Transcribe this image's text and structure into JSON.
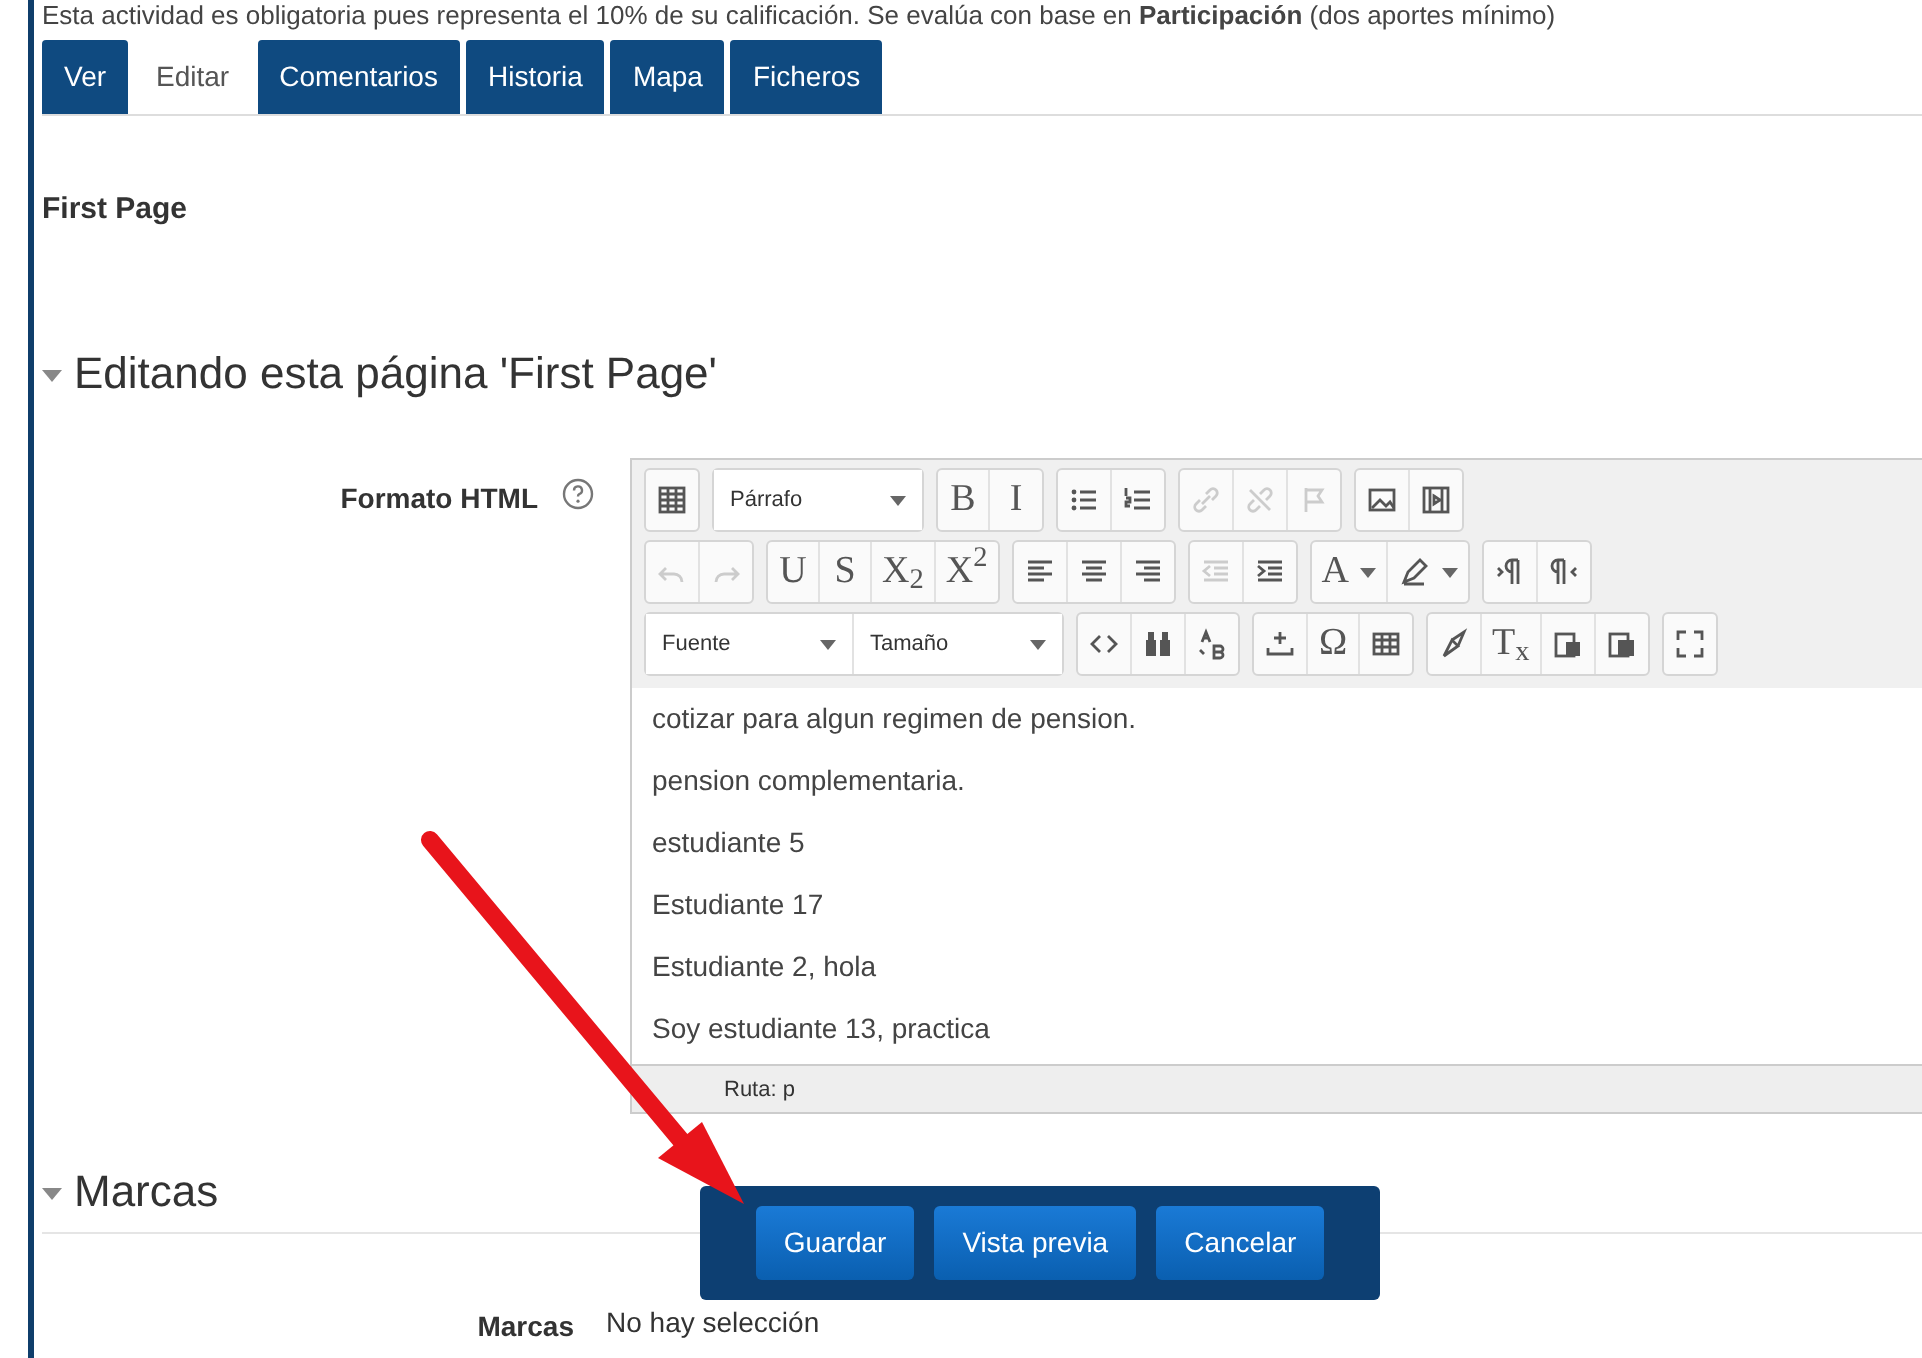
{
  "notice": "Esta actividad es obligatoria pues representa el 10% de su calificación. Se evalúa con base en **Participación** (dos aportes mínimo)",
  "tabs": [
    {
      "label": "Ver",
      "selected": false
    },
    {
      "label": "Editar",
      "selected": true
    },
    {
      "label": "Comentarios",
      "selected": false
    },
    {
      "label": "Historia",
      "selected": false
    },
    {
      "label": "Mapa",
      "selected": false
    },
    {
      "label": "Ficheros",
      "selected": false
    }
  ],
  "page_title": "First Page",
  "section_heading": "Editando esta página 'First Page'",
  "editor": {
    "label": "Formato HTML",
    "toolbar": [
      [
        [
          {
            "kind": "icon",
            "disabled": false
          }
        ],
        [
          {
            "kind": "select",
            "label": "Párrafo"
          }
        ],
        [
          {
            "kind": "text",
            "label": "B",
            "disabled": false
          },
          {
            "kind": "text",
            "label": "I",
            "disabled": false
          }
        ],
        [
          {
            "kind": "icon",
            "disabled": false
          },
          {
            "kind": "icon",
            "disabled": false
          }
        ],
        [
          {
            "kind": "icon",
            "disabled": true
          },
          {
            "kind": "icon",
            "disabled": true
          },
          {
            "kind": "icon",
            "disabled": true
          }
        ],
        [
          {
            "kind": "icon",
            "disabled": false
          },
          {
            "kind": "icon",
            "disabled": false
          }
        ]
      ],
      [
        [
          {
            "kind": "icon",
            "disabled": true
          },
          {
            "kind": "icon",
            "disabled": true
          }
        ],
        [
          {
            "kind": "text",
            "label": "U",
            "disabled": false
          },
          {
            "kind": "text",
            "label": "S",
            "disabled": false
          },
          {
            "kind": "text",
            "label": "X$_{2}$",
            "disabled": false
          },
          {
            "kind": "text",
            "label": "X$^{2}$",
            "disabled": false
          }
        ],
        [
          {
            "kind": "icon",
            "disabled": false
          },
          {
            "kind": "icon",
            "disabled": false
          },
          {
            "kind": "icon",
            "disabled": false
          }
        ],
        [
          {
            "kind": "icon",
            "disabled": true
          },
          {
            "kind": "icon",
            "disabled": false
          }
        ],
        [
          {
            "kind": "split",
            "label": "A",
            "disabled": false
          },
          {
            "kind": "split_icon",
            "disabled": false
          }
        ],
        [
          {
            "kind": "icon",
            "disabled": false
          },
          {
            "kind": "icon",
            "disabled": false
          }
        ]
      ],
      [
        [
          {
            "kind": "select",
            "label": "Fuente"
          },
          {
            "kind": "select",
            "label": "Tamaño"
          }
        ],
        [
          {
            "kind": "icon",
            "disabled": false
          },
          {
            "kind": "icon",
            "disabled": false
          },
          {
            "kind": "icon",
            "disabled": false
          }
        ],
        [
          {
            "kind": "icon",
            "disabled": false
          },
          {
            "kind": "text",
            "label": "Ω",
            "disabled": false
          },
          {
            "kind": "icon",
            "disabled": false
          }
        ],
        [
          {
            "kind": "icon",
            "disabled": false
          },
          {
            "kind": "text",
            "label": "T$_{x}$",
            "disabled": false
          },
          {
            "kind": "icon",
            "disabled": false
          },
          {
            "kind": "icon",
            "disabled": false
          }
        ],
        [
          {
            "kind": "icon",
            "disabled": false
          }
        ]
      ]
    ],
    "lines": [
      "cotizar para algun regimen de pension.",
      "pension complementaria.",
      "estudiante 5",
      "Estudiante 17",
      "Estudiante 2, hola",
      "Soy estudiante 13, practica"
    ],
    "path": "Ruta: p"
  },
  "tags_heading": "Marcas",
  "tags_field": {
    "label": "Marcas",
    "value": "No hay selección"
  },
  "buttons": [
    "Guardar",
    "Vista previa",
    "Cancelar"
  ]
}
